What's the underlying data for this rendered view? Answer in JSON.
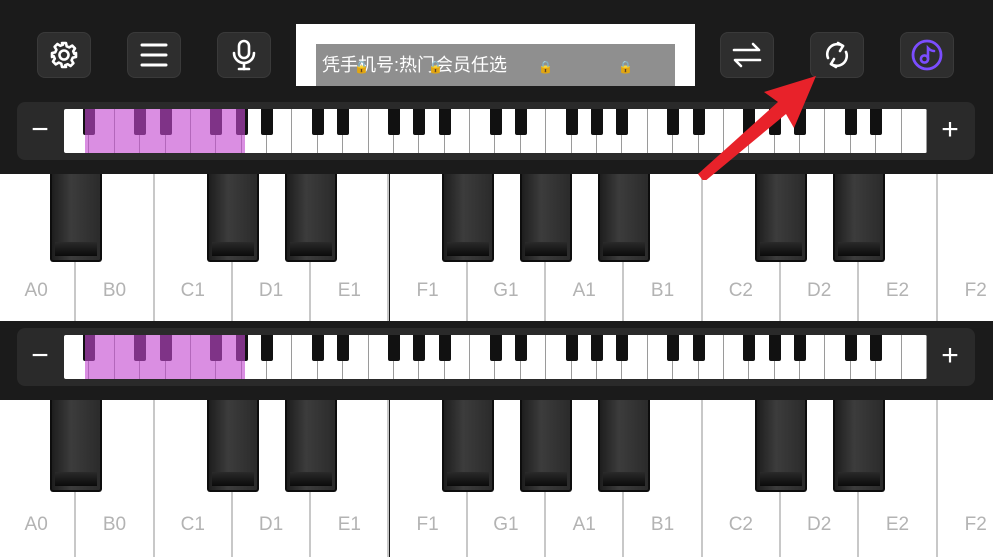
{
  "toolbar": {
    "left_buttons": [
      {
        "name": "settings-button",
        "icon": "gear-icon"
      },
      {
        "name": "menu-button",
        "icon": "hamburger-menu-icon"
      },
      {
        "name": "microphone-button",
        "icon": "microphone-icon"
      }
    ],
    "right_buttons": [
      {
        "name": "swap-button",
        "icon": "swap-arrows-icon"
      },
      {
        "name": "refresh-button",
        "icon": "rotate-arrows-icon"
      },
      {
        "name": "music-note-button",
        "icon": "music-note-icon"
      }
    ],
    "accent_color": "#7b4dff"
  },
  "ad_banner": {
    "text": "凭手机号:热门会员任选"
  },
  "keyboard_strip": {
    "minus_label": "−",
    "plus_label": "+",
    "selection_color": "#c348d0"
  },
  "big_keyboard": {
    "white_keys": [
      "A0",
      "B0",
      "C1",
      "D1",
      "E1",
      "F1",
      "G1",
      "A1",
      "B1",
      "C2",
      "D2",
      "E2",
      "F2"
    ]
  },
  "annotation": {
    "arrow_color": "#e8222a"
  }
}
